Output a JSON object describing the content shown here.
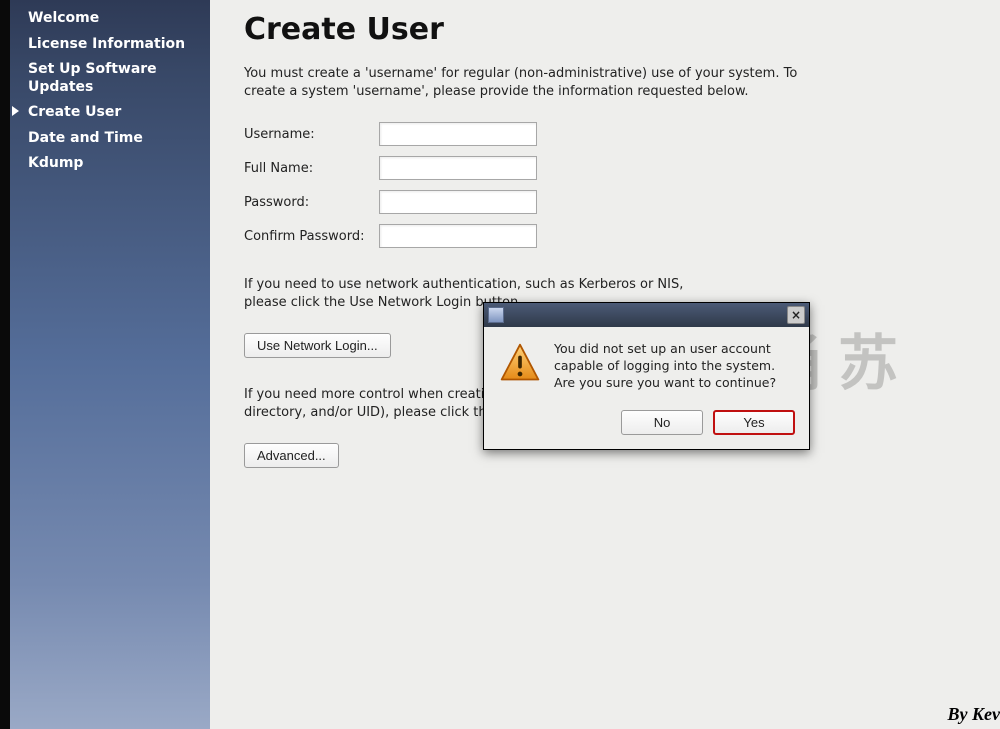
{
  "sidebar": {
    "items": [
      {
        "label": "Welcome",
        "active": false
      },
      {
        "label": "License Information",
        "active": false
      },
      {
        "label": "Set Up Software Updates",
        "active": false
      },
      {
        "label": "Create User",
        "active": true
      },
      {
        "label": "Date and Time",
        "active": false
      },
      {
        "label": "Kdump",
        "active": false
      }
    ]
  },
  "page": {
    "title": "Create User",
    "intro": "You must create a 'username' for regular (non-administrative) use of your system.  To create a system 'username', please provide the information requested below.",
    "labels": {
      "username": "Username:",
      "fullname": "Full Name:",
      "password": "Password:",
      "confirm": "Confirm Password:"
    },
    "values": {
      "username": "",
      "fullname": "",
      "password": "",
      "confirm": ""
    },
    "network_text": "If you need to use network authentication, such as Kerberos or NIS, please click the Use Network Login button.",
    "network_button": "Use Network Login...",
    "advanced_text": "If you need more control when creating the user (specifying home directory, and/or UID), please click the Advanced button.",
    "advanced_button": "Advanced..."
  },
  "dialog": {
    "title": "",
    "message": "You did not set up an user account capable of logging into the system. Are you sure you want to continue?",
    "no_label": "No",
    "yes_label": "Yes",
    "close_glyph": "×"
  },
  "watermark": "兵马俑苏",
  "byline": "By Kev"
}
